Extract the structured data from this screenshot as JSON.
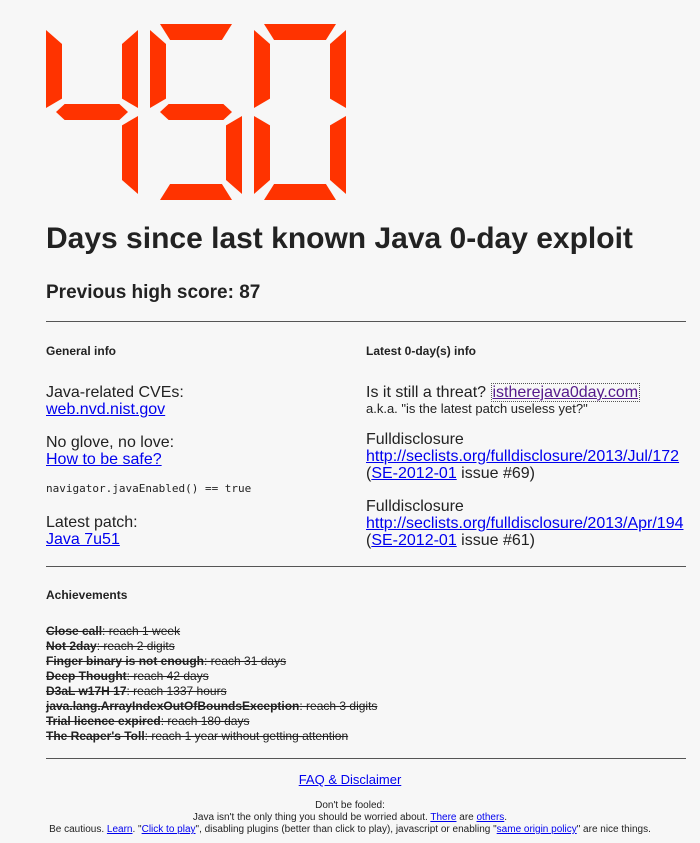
{
  "counter": {
    "value": "450",
    "color": "#ff3300"
  },
  "headline": "Days since last known Java 0-day exploit",
  "high_score": "Previous high score: 87",
  "general": {
    "title": "General info",
    "cves_label": "Java-related CVEs:",
    "cves_link": "web.nvd.nist.gov",
    "glove_label": "No glove, no love:",
    "glove_link": "How to be safe?",
    "code": "navigator.javaEnabled() == true",
    "patch_label": "Latest patch:",
    "patch_link": "Java 7u51"
  },
  "latest": {
    "title": "Latest 0-day(s) info",
    "threat_label": "Is it still a threat?",
    "threat_link": "istherejava0day.com",
    "threat_aka": "a.k.a. \"is the latest patch useless yet?\"",
    "entries": [
      {
        "source": "Fulldisclosure",
        "url": "http://seclists.org/fulldisclosure/2013/Jul/172",
        "ref": "SE-2012-01",
        "issue": " issue #69)"
      },
      {
        "source": "Fulldisclosure",
        "url": "http://seclists.org/fulldisclosure/2013/Apr/194",
        "ref": "SE-2012-01",
        "issue": " issue #61)"
      }
    ]
  },
  "achievements": {
    "title": "Achievements",
    "items": [
      {
        "name": "Close call",
        "desc": ": reach 1 week"
      },
      {
        "name": "Not 2day",
        "desc": ": reach 2 digits"
      },
      {
        "name": "Finger binary is not enough",
        "desc": ": reach 31 days"
      },
      {
        "name": "Deep Thought",
        "desc": ": reach 42 days"
      },
      {
        "name": "D3aL w17H 17",
        "desc": ": reach 1337 hours"
      },
      {
        "name": "java.lang.ArrayIndexOutOfBoundsException",
        "desc": ": reach 3 digits"
      },
      {
        "name": "Trial licence expired",
        "desc": ": reach 180 days"
      },
      {
        "name": "The Reaper's Toll",
        "desc": ": reach 1 year without getting attention"
      }
    ]
  },
  "footer": {
    "faq_link": "FAQ & Disclaimer",
    "line1": "Don't be fooled:",
    "line2_a": "Java isn't the only thing you should be worried about. ",
    "there_link": "There",
    "line2_b": " are ",
    "others_link": "others",
    "line2_c": ".",
    "line3_a": "Be cautious. ",
    "learn_link": "Learn",
    "line3_b": ". \"",
    "click_link": "Click to play",
    "line3_c": "\", disabling plugins (better than click to play), javascript or enabling \"",
    "sop_link": "same origin policy",
    "line3_d": "\" are nice things."
  }
}
